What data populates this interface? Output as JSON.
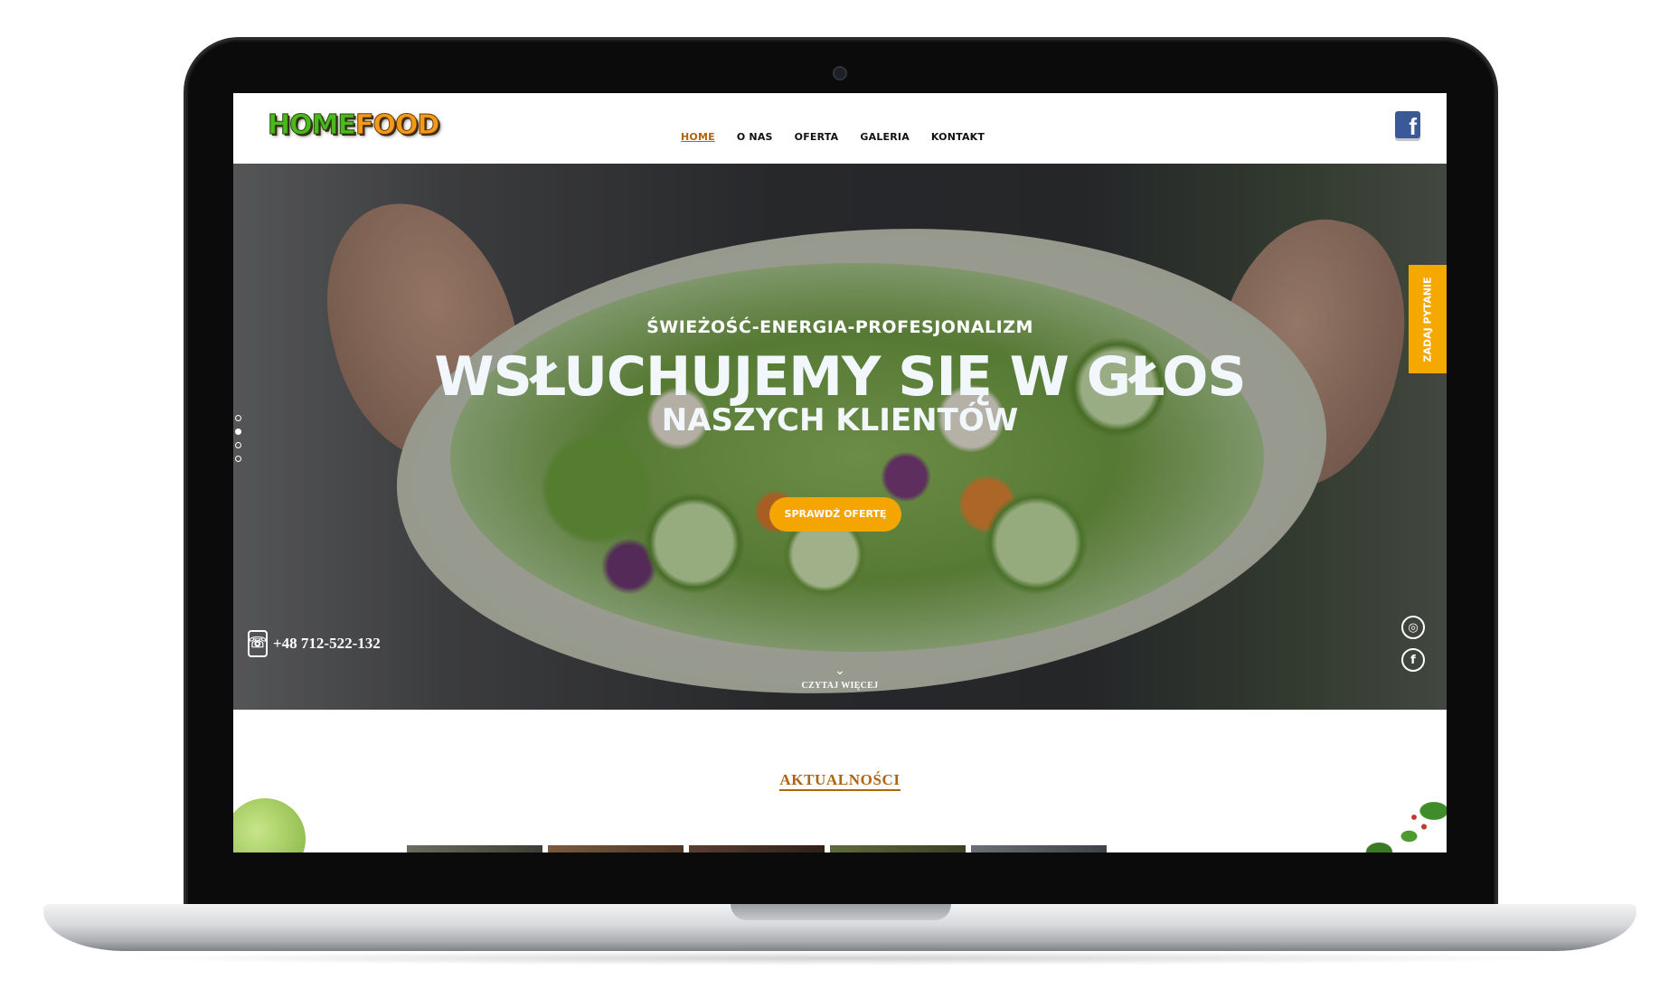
{
  "site": {
    "logo": {
      "part1": "HOME",
      "part2": "FOOD"
    },
    "nav": [
      {
        "label": "HOME",
        "active": true
      },
      {
        "label": "O NAS",
        "active": false
      },
      {
        "label": "OFERTA",
        "active": false
      },
      {
        "label": "GALERIA",
        "active": false
      },
      {
        "label": "KONTAKT",
        "active": false
      }
    ],
    "header_social_icon": "facebook-icon"
  },
  "hero": {
    "kicker": "ŚWIEŻOŚĆ-ENERGIA-PROFESJONALIZM",
    "title": "WSŁUCHUJEMY SIĘ W GŁOS",
    "subtitle": "NASZYCH KLIENTÓW",
    "cta_label": "SPRAWDŹ OFERTĘ",
    "slider_dots": 4,
    "active_dot": 2,
    "phone": "+48 712-522-132",
    "side_tab": "ZADAJ PYTANIE",
    "read_more": "CZYTAJ WIĘCEJ",
    "social_icons": [
      "instagram-icon",
      "facebook-icon"
    ]
  },
  "news": {
    "heading": "AKTUALNOŚCI"
  },
  "colors": {
    "accent": "#f5a500",
    "heading_brown": "#b06412",
    "facebook": "#3b5998",
    "logo_green": "#4db81e",
    "logo_orange": "#f39a1a"
  }
}
